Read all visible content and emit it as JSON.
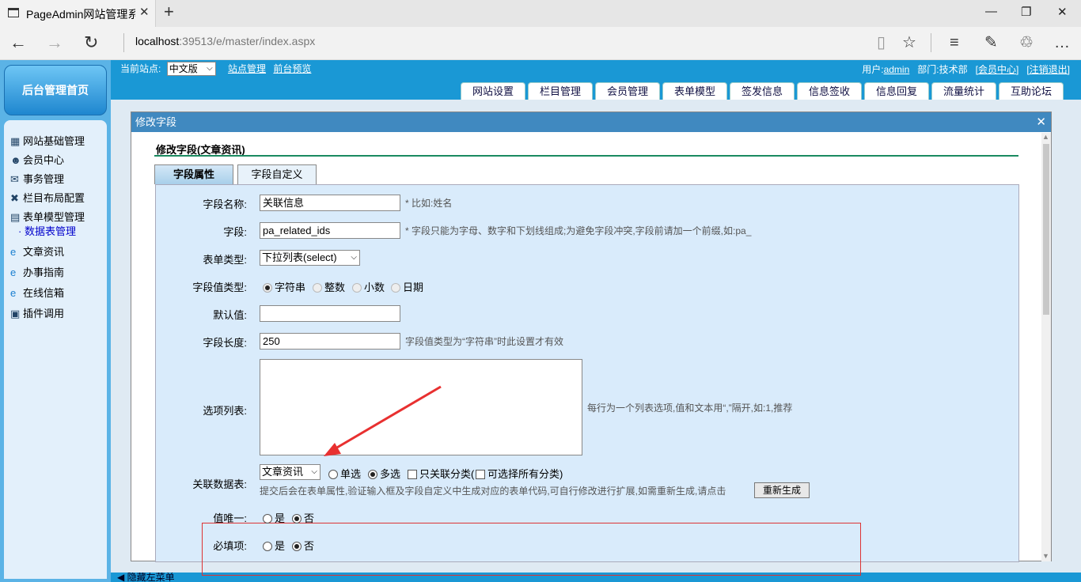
{
  "browser": {
    "tab_title": "PageAdmin网站管理系统",
    "url_host": "localhost",
    "url_rest": ":39513/e/master/index.aspx"
  },
  "sidebar": {
    "home_label": "后台管理首页",
    "items": [
      {
        "label": "网站基础管理",
        "icon": "settings-icon"
      },
      {
        "label": "会员中心",
        "icon": "users-icon"
      },
      {
        "label": "事务管理",
        "icon": "task-icon"
      },
      {
        "label": "栏目布局配置",
        "icon": "tools-icon"
      },
      {
        "label": "表单模型管理",
        "icon": "book-icon"
      },
      {
        "label": "· 数据表管理",
        "icon": ""
      },
      {
        "label": "文章资讯",
        "icon": "ie-icon"
      },
      {
        "label": "办事指南",
        "icon": "ie-icon"
      },
      {
        "label": "在线信箱",
        "icon": "ie-icon"
      },
      {
        "label": "插件调用",
        "icon": "plugin-icon"
      }
    ]
  },
  "topbar": {
    "site_label": "当前站点:",
    "site_value": "中文版",
    "link_site_manage": "站点管理",
    "link_preview": "前台预览",
    "user_label": "用户:",
    "user_name": "admin",
    "dept_label": "部门:",
    "dept_name": "技术部",
    "member_center": "[会员中心]",
    "logout": "[注销退出]",
    "tabs": [
      "网站设置",
      "栏目管理",
      "会员管理",
      "表单模型",
      "签发信息",
      "信息签收",
      "信息回复",
      "流量统计",
      "互助论坛"
    ]
  },
  "dialog": {
    "title": "修改字段",
    "page_title": "修改字段(文章资讯)",
    "tabs": [
      "字段属性",
      "字段自定义"
    ],
    "fields": {
      "name_label": "字段名称:",
      "name_value": "关联信息",
      "name_hint": "* 比如:姓名",
      "field_label": "字段:",
      "field_value": "pa_related_ids",
      "field_hint": "* 字段只能为字母、数字和下划线组成;为避免字段冲突,字段前请加一个前缀,如:pa_",
      "formtype_label": "表单类型:",
      "formtype_value": "下拉列表(select)",
      "valuetype_label": "字段值类型:",
      "valuetype_options": [
        "字符串",
        "整数",
        "小数",
        "日期"
      ],
      "default_label": "默认值:",
      "default_value": "",
      "length_label": "字段长度:",
      "length_value": "250",
      "length_hint": "字段值类型为“字符串”时此设置才有效",
      "options_label": "选项列表:",
      "options_hint": "每行为一个列表选项,值和文本用“,”隔开,如:1,推荐",
      "relation_label": "关联数据表:",
      "relation_value": "文章资讯",
      "relation_single": "单选",
      "relation_multi": "多选",
      "relation_only_cat": "只关联分类(",
      "relation_all_cat": "可选择所有分类)",
      "relation_note": "提交后会在表单属性,验证输入框及字段自定义中生成对应的表单代码,可自行修改进行扩展,如需重新生成,请点击",
      "regen_button": "重新生成",
      "unique_label": "值唯一:",
      "required_label": "必填项:",
      "yes": "是",
      "no": "否"
    }
  },
  "bottom": {
    "hide_menu": "◀ 隐藏左菜单"
  }
}
